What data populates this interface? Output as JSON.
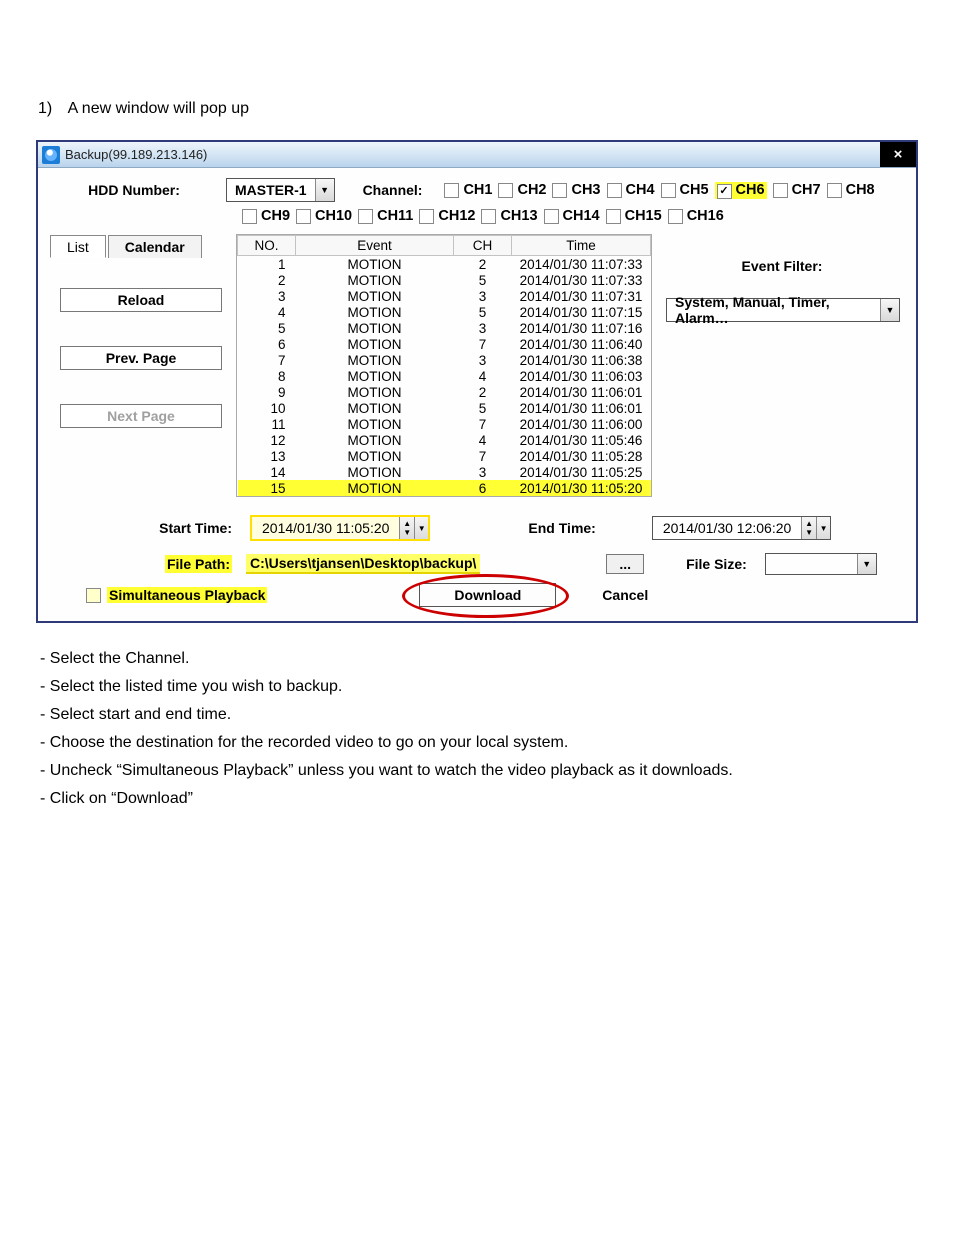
{
  "step": {
    "num": "1)",
    "text": "A new window will pop up"
  },
  "window": {
    "title": "Backup(99.189.213.146)"
  },
  "hdd": {
    "label": "HDD Number:",
    "value": "MASTER-1"
  },
  "channel_label": "Channel:",
  "channels_row1": [
    {
      "name": "CH1",
      "checked": false
    },
    {
      "name": "CH2",
      "checked": false
    },
    {
      "name": "CH3",
      "checked": false
    },
    {
      "name": "CH4",
      "checked": false
    },
    {
      "name": "CH5",
      "checked": false
    },
    {
      "name": "CH6",
      "checked": true
    },
    {
      "name": "CH7",
      "checked": false
    },
    {
      "name": "CH8",
      "checked": false
    }
  ],
  "channels_row2": [
    {
      "name": "CH9"
    },
    {
      "name": "CH10"
    },
    {
      "name": "CH11"
    },
    {
      "name": "CH12"
    },
    {
      "name": "CH13"
    },
    {
      "name": "CH14"
    },
    {
      "name": "CH15"
    },
    {
      "name": "CH16"
    }
  ],
  "tabs": {
    "list": "List",
    "calendar": "Calendar"
  },
  "nav": {
    "reload": "Reload",
    "prev": "Prev. Page",
    "next": "Next Page"
  },
  "table": {
    "headers": {
      "no": "NO.",
      "event": "Event",
      "ch": "CH",
      "time": "Time"
    },
    "rows": [
      {
        "no": "1",
        "event": "MOTION",
        "ch": "2",
        "time": "2014/01/30 11:07:33"
      },
      {
        "no": "2",
        "event": "MOTION",
        "ch": "5",
        "time": "2014/01/30 11:07:33"
      },
      {
        "no": "3",
        "event": "MOTION",
        "ch": "3",
        "time": "2014/01/30 11:07:31"
      },
      {
        "no": "4",
        "event": "MOTION",
        "ch": "5",
        "time": "2014/01/30 11:07:15"
      },
      {
        "no": "5",
        "event": "MOTION",
        "ch": "3",
        "time": "2014/01/30 11:07:16"
      },
      {
        "no": "6",
        "event": "MOTION",
        "ch": "7",
        "time": "2014/01/30 11:06:40"
      },
      {
        "no": "7",
        "event": "MOTION",
        "ch": "3",
        "time": "2014/01/30 11:06:38"
      },
      {
        "no": "8",
        "event": "MOTION",
        "ch": "4",
        "time": "2014/01/30 11:06:03"
      },
      {
        "no": "9",
        "event": "MOTION",
        "ch": "2",
        "time": "2014/01/30 11:06:01"
      },
      {
        "no": "10",
        "event": "MOTION",
        "ch": "5",
        "time": "2014/01/30 11:06:01"
      },
      {
        "no": "11",
        "event": "MOTION",
        "ch": "7",
        "time": "2014/01/30 11:06:00"
      },
      {
        "no": "12",
        "event": "MOTION",
        "ch": "4",
        "time": "2014/01/30 11:05:46"
      },
      {
        "no": "13",
        "event": "MOTION",
        "ch": "7",
        "time": "2014/01/30 11:05:28"
      },
      {
        "no": "14",
        "event": "MOTION",
        "ch": "3",
        "time": "2014/01/30 11:05:25"
      },
      {
        "no": "15",
        "event": "MOTION",
        "ch": "6",
        "time": "2014/01/30 11:05:20",
        "selected": true
      }
    ]
  },
  "filter": {
    "label": "Event Filter:",
    "value": "System, Manual, Timer, Alarm…"
  },
  "start": {
    "label": "Start Time:",
    "value": "2014/01/30 11:05:20"
  },
  "end": {
    "label": "End Time:",
    "value": "2014/01/30 12:06:20"
  },
  "filepath": {
    "label": "File Path:",
    "value": "C:\\Users\\tjansen\\Desktop\\backup\\",
    "browse": "..."
  },
  "filesize": {
    "label": "File Size:"
  },
  "sim": {
    "label": "Simultaneous Playback"
  },
  "download": "Download",
  "cancel": "Cancel",
  "instructions": [
    "- Select the Channel.",
    "- Select the listed time you wish to backup.",
    "- Select start and end time.",
    "- Choose the destination for the recorded video to go on your local system.",
    "- Uncheck “Simultaneous Playback” unless you want to watch the video playback as it downloads.",
    "- Click on “Download”"
  ]
}
